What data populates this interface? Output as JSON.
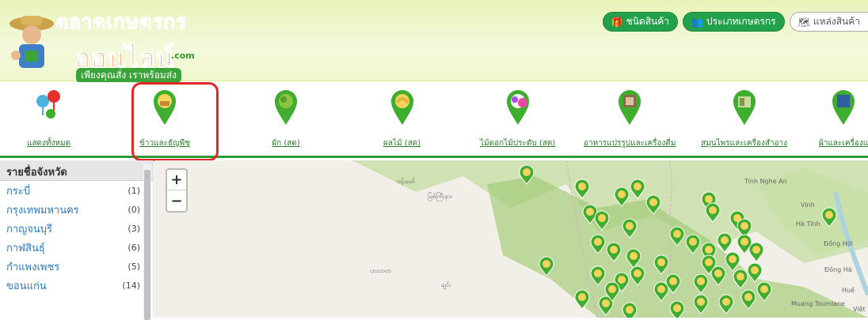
{
  "header": {
    "logo_title": "ตลาดเกษตรกร",
    "logo_sub": "ออนไลน์",
    "logo_com": ".com",
    "logo_slogan": "เพียงคุณสั่ง เราพร้อมส่ง",
    "buttons": [
      {
        "label": "ชนิดสินค้า",
        "icon": "gift-icon"
      },
      {
        "label": "ประเภทเกษตรกร",
        "icon": "users-icon"
      },
      {
        "label": "แหล่งสินค้า",
        "icon": "map-icon"
      }
    ]
  },
  "categories": [
    {
      "label": "แสดงทั้งหมด"
    },
    {
      "label": "ข้าวและธัญพืช"
    },
    {
      "label": "ผัก (สด)"
    },
    {
      "label": "ผลไม้ (สด)"
    },
    {
      "label": "ไม้ดอกไม้ประดับ (สด)"
    },
    {
      "label": "อาหารแปรรูปและเครื่องดื่ม"
    },
    {
      "label": "สมุนไพรและเครื่องสำอาง"
    },
    {
      "label": "ผ้าและเครื่องแ"
    }
  ],
  "sidebar": {
    "title": "รายชื่อจังหวัด",
    "provinces": [
      {
        "name": "กระบี่",
        "count": "(1)"
      },
      {
        "name": "กรุงเทพมหานคร",
        "count": "(0)"
      },
      {
        "name": "กาญจนบุรี",
        "count": "(3)"
      },
      {
        "name": "กาฬสินธุ์",
        "count": "(6)"
      },
      {
        "name": "กำแพงเพชร",
        "count": "(5)"
      },
      {
        "name": "ขอนแก่น",
        "count": "(14)"
      }
    ]
  },
  "map": {
    "zoom_in": "+",
    "zoom_out": "−",
    "labels": {
      "l1": "ဗန်းမော်",
      "l2": "မြစ်ကြီးနား",
      "l3": "Tinh Nghe An",
      "l4": "Vinh",
      "l5": "Hà Tĩnh",
      "l6": "Đồng Hới",
      "l7": "Đông Hà",
      "l8": "Huế",
      "l9": "Muang Toumlane",
      "l10": "Việt",
      "l11": "ဟသာတ",
      "l12": "ချင်း"
    }
  },
  "colors": {
    "brand_green": "#22a14a",
    "highlight_red": "#e32626",
    "pin_green": "#3fae2e",
    "water": "#aad3df",
    "land": "#f2efe9"
  }
}
